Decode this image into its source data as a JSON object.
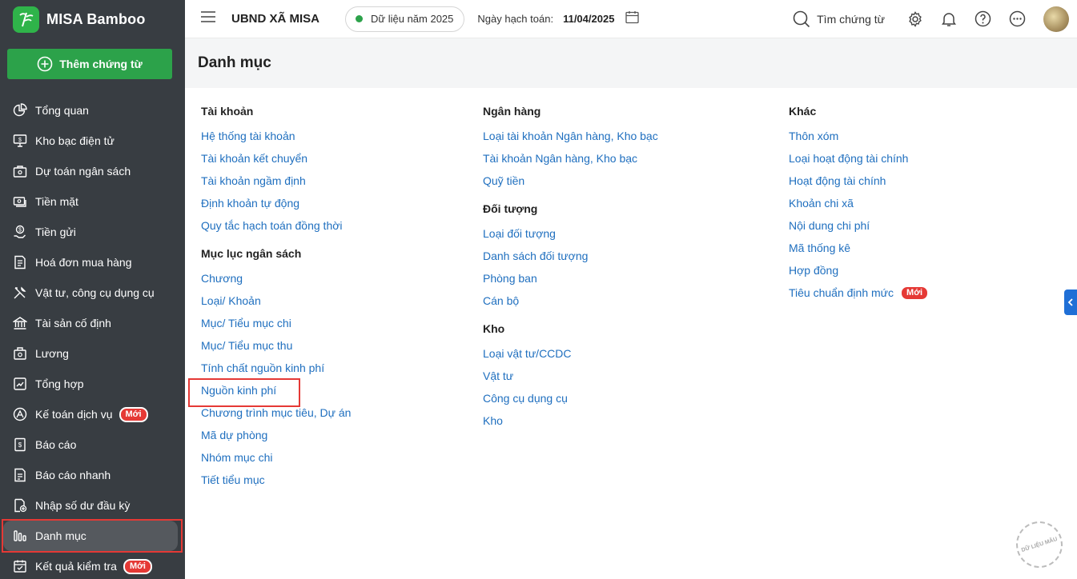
{
  "brand": {
    "name": "MISA Bamboo"
  },
  "sidebar": {
    "add_button": "Thêm chứng từ",
    "badge_new": "Mới",
    "items": [
      {
        "label": "Tổng quan",
        "icon": "pie-chart-icon"
      },
      {
        "label": "Kho bạc điện tử",
        "icon": "monitor-icon"
      },
      {
        "label": "Dự toán ngân sách",
        "icon": "briefcase-icon"
      },
      {
        "label": "Tiền mặt",
        "icon": "cash-icon"
      },
      {
        "label": "Tiền gửi",
        "icon": "deposit-icon"
      },
      {
        "label": "Hoá đơn mua hàng",
        "icon": "invoice-icon"
      },
      {
        "label": "Vật tư, công cụ dụng cụ",
        "icon": "tools-icon"
      },
      {
        "label": "Tài sản cố định",
        "icon": "bank-icon"
      },
      {
        "label": "Lương",
        "icon": "salary-icon"
      },
      {
        "label": "Tổng hợp",
        "icon": "summary-icon"
      },
      {
        "label": "Kế toán dịch vụ",
        "icon": "service-icon"
      },
      {
        "label": "Báo cáo",
        "icon": "report-icon"
      },
      {
        "label": "Báo cáo nhanh",
        "icon": "quick-report-icon"
      },
      {
        "label": "Nhập số dư đầu kỳ",
        "icon": "opening-balance-icon"
      },
      {
        "label": "Danh mục",
        "icon": "catalog-icon"
      },
      {
        "label": "Kết quả kiểm tra",
        "icon": "check-result-icon"
      }
    ]
  },
  "topbar": {
    "org_name": "UBND XÃ MISA",
    "data_year": "Dữ liệu năm 2025",
    "posting_date_label": "Ngày hạch toán:",
    "posting_date": "11/04/2025",
    "search_label": "Tìm chứng từ"
  },
  "page": {
    "title": "Danh mục"
  },
  "catalog": {
    "col1": [
      {
        "title": "Tài khoản",
        "links": [
          "Hệ thống tài khoản",
          "Tài khoản kết chuyển",
          "Tài khoản ngầm định",
          "Định khoản tự động",
          "Quy tắc hạch toán đồng thời"
        ]
      },
      {
        "title": "Mục lục ngân sách",
        "links": [
          "Chương",
          "Loại/ Khoản",
          "Mục/ Tiểu mục chi",
          "Mục/ Tiểu mục thu",
          "Tính chất nguồn kinh phí",
          "Nguồn kinh phí",
          "Chương trình mục tiêu, Dự án",
          "Mã dự phòng",
          "Nhóm mục chi",
          "Tiết tiểu mục"
        ]
      }
    ],
    "col2": [
      {
        "title": "Ngân hàng",
        "links": [
          "Loại tài khoản Ngân hàng, Kho bạc",
          "Tài khoản Ngân hàng, Kho bạc",
          "Quỹ tiền"
        ]
      },
      {
        "title": "Đối tượng",
        "links": [
          "Loại đối tượng",
          "Danh sách đối tượng",
          "Phòng ban",
          "Cán bộ"
        ]
      },
      {
        "title": "Kho",
        "links": [
          "Loại vật tư/CCDC",
          "Vật tư",
          "Công cụ dụng cụ",
          "Kho"
        ]
      }
    ],
    "col3": [
      {
        "title": "Khác",
        "links": [
          "Thôn xóm",
          "Loại hoạt động tài chính",
          "Hoạt động tài chính",
          "Khoản chi xã",
          "Nội dung chi phí",
          "Mã thống kê",
          "Hợp đồng",
          "Tiêu chuẩn định mức"
        ]
      }
    ]
  },
  "watermark": "DỮ LIỆU MẪU"
}
